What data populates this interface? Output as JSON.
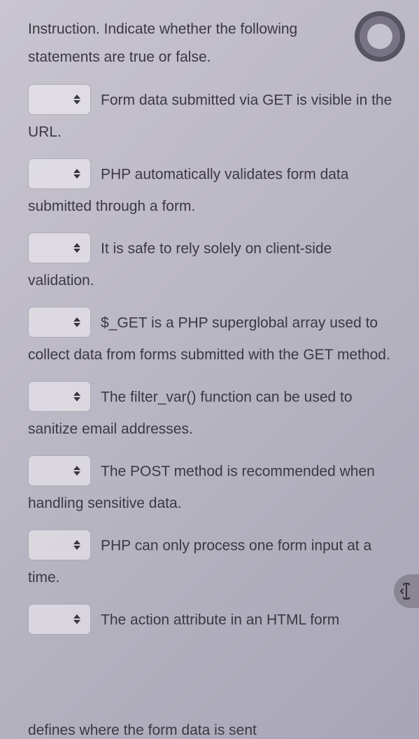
{
  "instruction": "Instruction.  Indicate whether the following statements are true or false.",
  "questions": [
    {
      "text": "Form data submitted via GET is visible in the URL."
    },
    {
      "text": "PHP automatically validates form data submitted through a form."
    },
    {
      "text": "It is safe to rely solely on client-side validation."
    },
    {
      "text": "$_GET is a PHP superglobal array used to collect data from forms submitted with the GET method."
    },
    {
      "text": "The filter_var() function can be used to sanitize email addresses."
    },
    {
      "text": "The POST method is recommended when handling sensitive data."
    },
    {
      "text": "PHP can only process one form input at a time."
    },
    {
      "text": "The action attribute in an HTML form"
    }
  ],
  "cutoff_text": "defines where the form data is sent"
}
